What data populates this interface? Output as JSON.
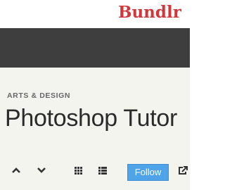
{
  "brand": {
    "logo_text": "Bundlr"
  },
  "header": {
    "category": "ARTS & DESIGN",
    "title": "Photoshop Tutor"
  },
  "toolbar": {
    "follow_label": "Follow",
    "icons": [
      "chevron-up-icon",
      "chevron-down-icon",
      "grid-view-icon",
      "list-view-icon",
      "share-icon"
    ]
  },
  "colors": {
    "brand": "#d0363a",
    "navbar": "#3e3e3e",
    "content_bg": "#f4f4ef",
    "follow_button": "#4fa3e8"
  }
}
